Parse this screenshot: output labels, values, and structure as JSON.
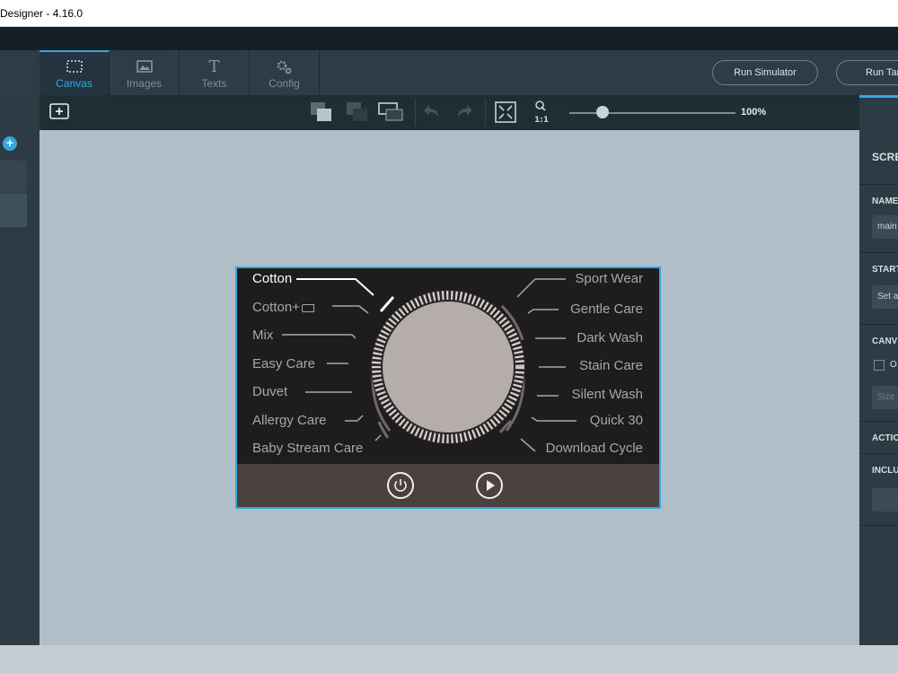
{
  "window": {
    "title": "Designer - 4.16.0"
  },
  "tabs": [
    {
      "label": "Canvas",
      "icon": "selection-icon"
    },
    {
      "label": "Images",
      "icon": "image-icon"
    },
    {
      "label": "Texts",
      "icon": "text-icon"
    },
    {
      "label": "Config",
      "icon": "config-icon"
    }
  ],
  "actions": {
    "run_simulator": "Run Simulator",
    "run_target": "Run Tar"
  },
  "zoom": {
    "level": "100%",
    "fraction": 0.2
  },
  "right_panel": {
    "screen_label": "SCRE",
    "name_label": "NAME",
    "name_value": "main",
    "start_label": "START",
    "start_value": "Set a",
    "canvas_label": "CANV",
    "canvas_option": "O",
    "size_placeholder": "Size",
    "actions_label": "ACTIO",
    "includes_label": "INCLU"
  },
  "dial": {
    "left_programs": [
      "Cotton",
      "Cotton+",
      "Mix",
      "Easy Care",
      "Duvet",
      "Allergy Care",
      "Baby Stream Care"
    ],
    "right_programs": [
      "Sport Wear",
      "Gentle Care",
      "Dark Wash",
      "Stain Care",
      "Silent Wash",
      "Quick 30",
      "Download Cycle"
    ],
    "selected": "Cotton"
  },
  "colors": {
    "accent": "#31a8e0",
    "screen_bg": "#1e1c1c",
    "knob": "#b4adab",
    "bottom_bar": "#4b4240"
  }
}
